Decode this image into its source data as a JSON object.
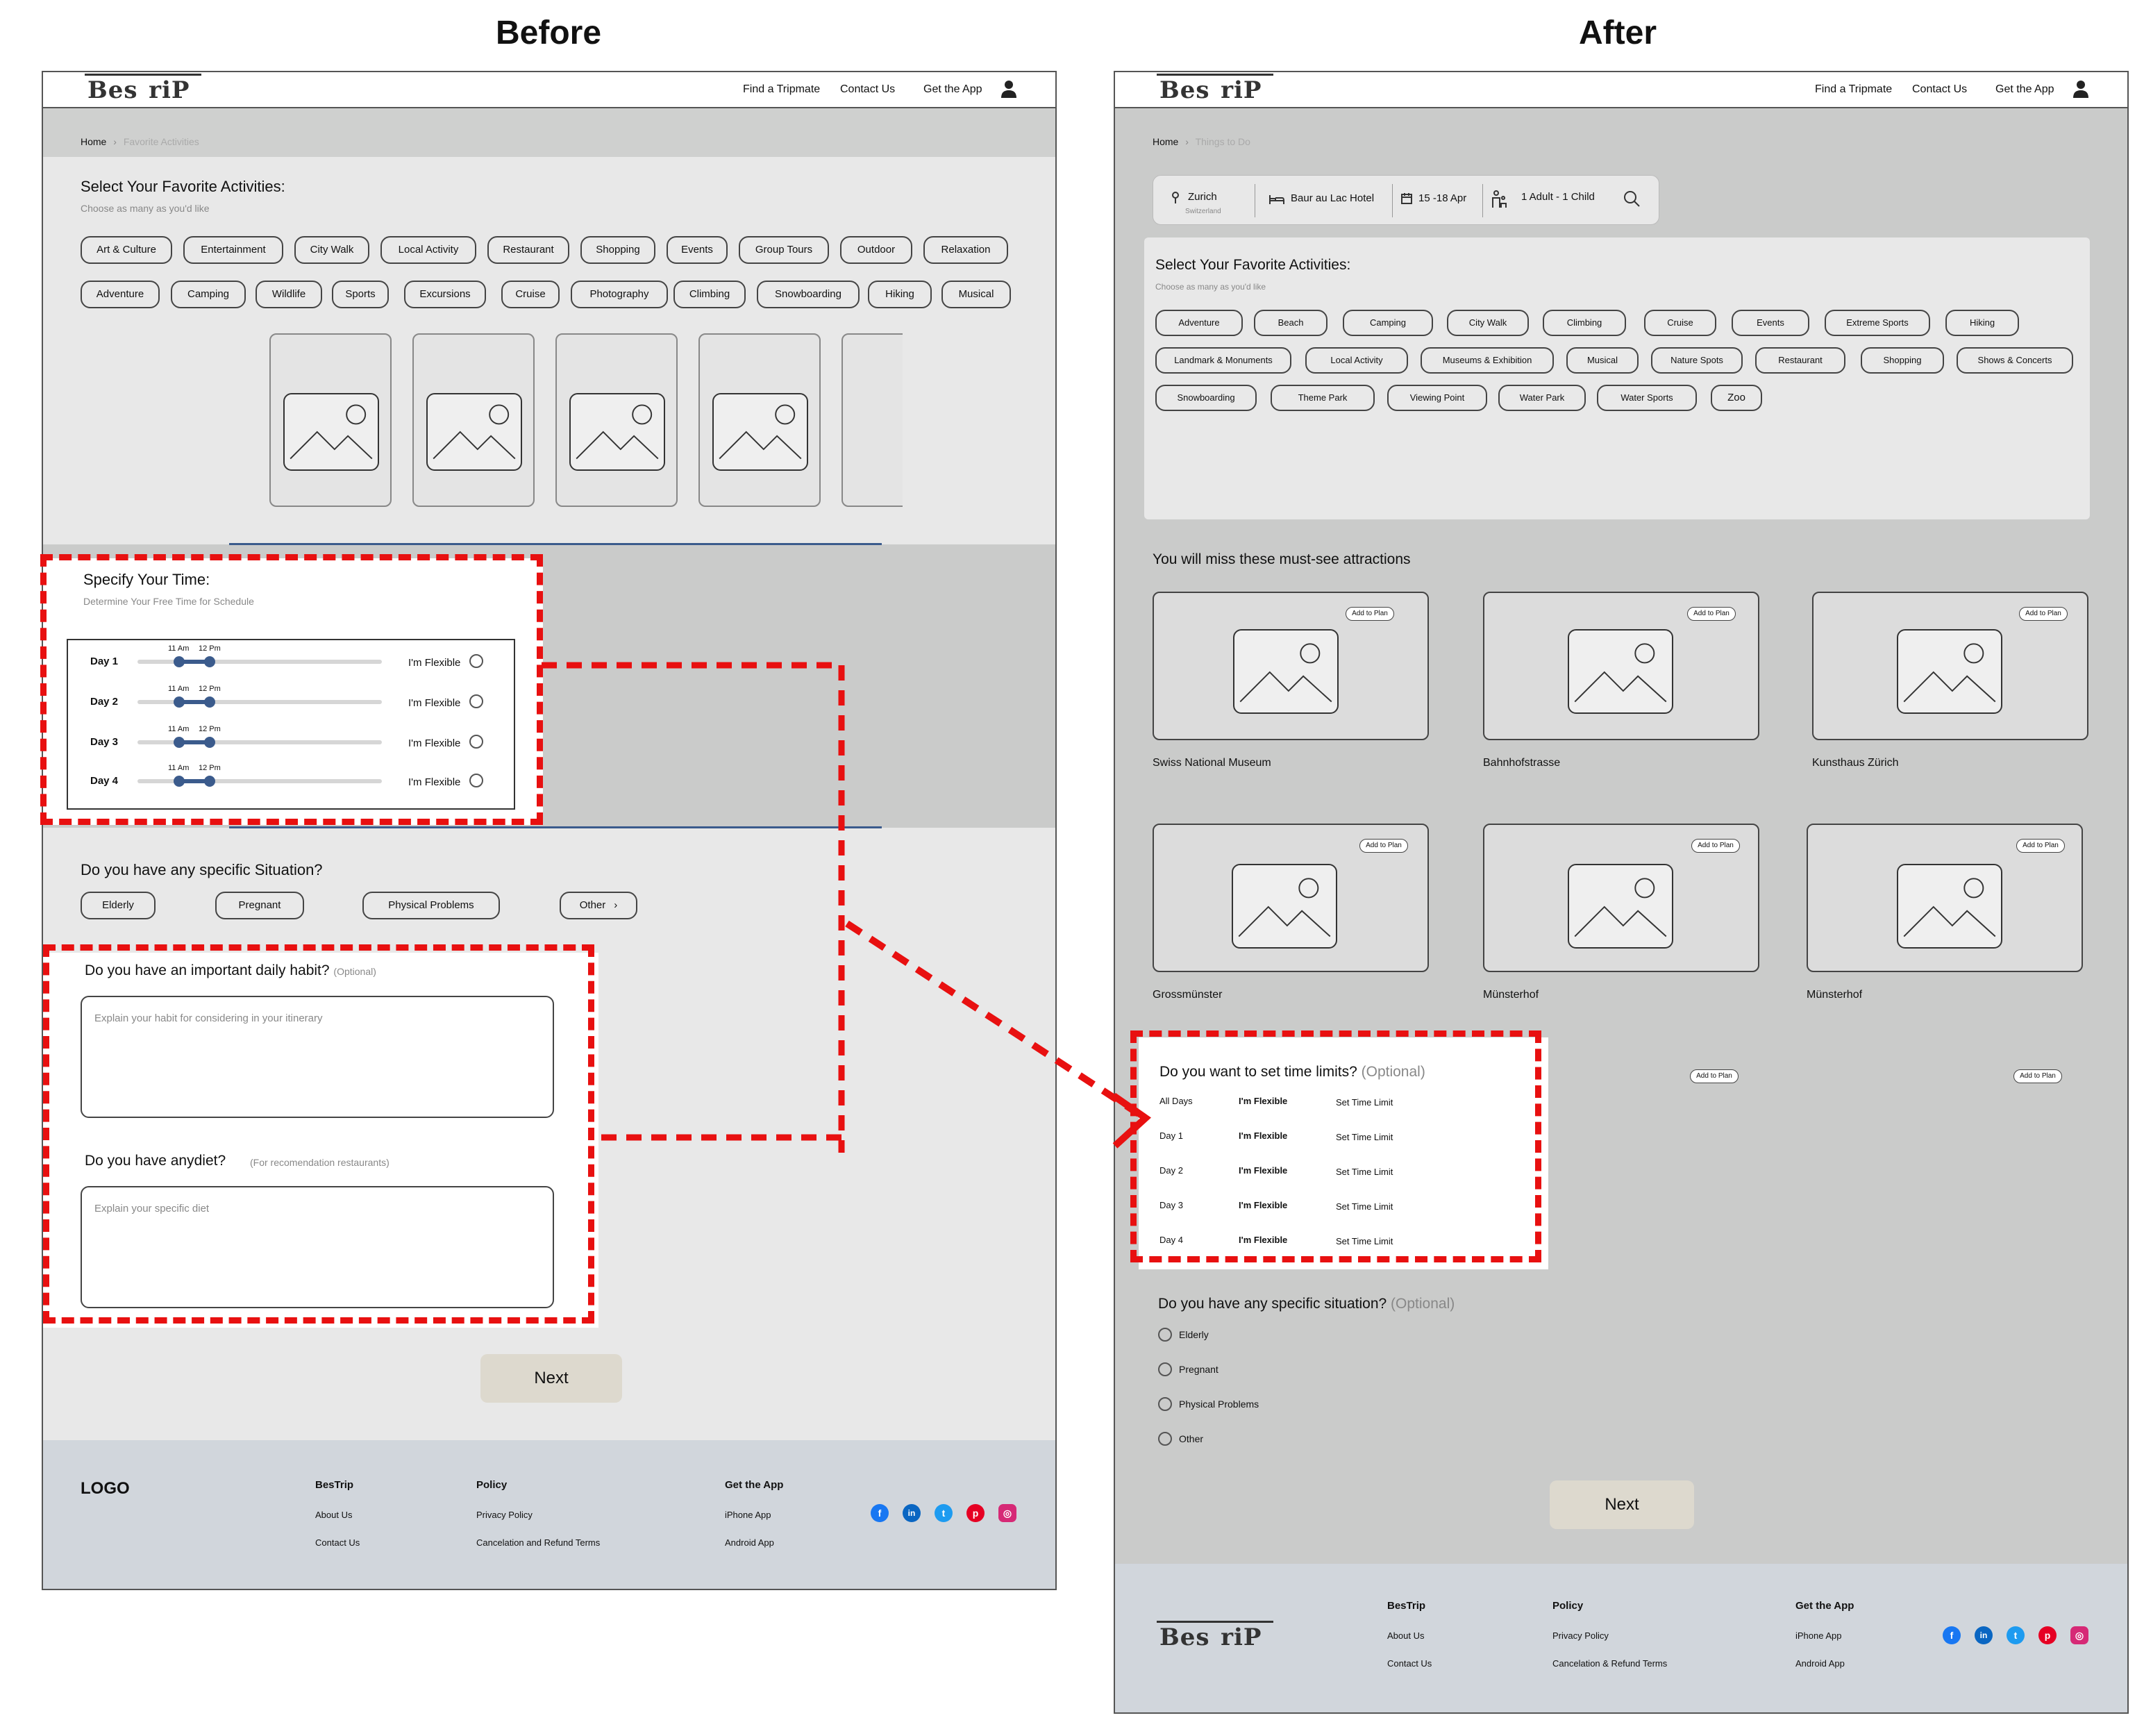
{
  "headings": {
    "before": "Before",
    "after": "After"
  },
  "nav": {
    "logo": "Bes  riP",
    "links": [
      "Find a Tripmate",
      "Contact Us",
      "Get the App"
    ]
  },
  "before": {
    "breadcrumb": {
      "home": "Home",
      "sep": "›",
      "current": "Favorite Activities"
    },
    "activities": {
      "title": "Select Your Favorite Activities:",
      "subtitle": "Choose as many as you'd like",
      "row1": [
        "Art & Culture",
        "Entertainment",
        "City Walk",
        "Local Activity",
        "Restaurant",
        "Shopping",
        "Events",
        "Group Tours",
        "Outdoor",
        "Relaxation"
      ],
      "row2": [
        "Adventure",
        "Camping",
        "Wildlife",
        "Sports",
        "Excursions",
        "Cruise",
        "Photography",
        "Climbing",
        "Snowboarding",
        "Hiking",
        "Musical"
      ]
    },
    "time": {
      "title": "Specify Your Time:",
      "subtitle": "Determine Your Free Time for Schedule",
      "days": [
        {
          "label": "Day 1",
          "from": "11 Am",
          "to": "12 Pm",
          "flex": "I'm Flexible"
        },
        {
          "label": "Day 2",
          "from": "11 Am",
          "to": "12 Pm",
          "flex": "I'm Flexible"
        },
        {
          "label": "Day 3",
          "from": "11 Am",
          "to": "12 Pm",
          "flex": "I'm Flexible"
        },
        {
          "label": "Day 4",
          "from": "11 Am",
          "to": "12 Pm",
          "flex": "I'm Flexible"
        }
      ]
    },
    "situation": {
      "title": "Do you have any specific Situation?",
      "options": [
        "Elderly",
        "Pregnant",
        "Physical Problems",
        "Other"
      ],
      "other_chev": "›"
    },
    "habit": {
      "title": "Do you have an important daily habit?",
      "optional": "(Optional)",
      "placeholder": "Explain your habit for considering in your itinerary"
    },
    "diet": {
      "title": "Do you have anydiet?",
      "note": "(For recomendation restaurants)",
      "placeholder": "Explain your specific diet"
    },
    "next": "Next",
    "footer": {
      "logo": "LOGO",
      "col1": {
        "head": "BesTrip",
        "links": [
          "About Us",
          "Contact Us"
        ]
      },
      "col2": {
        "head": "Policy",
        "links": [
          "Privacy Policy",
          "Cancelation and Refund Terms"
        ]
      },
      "col3": {
        "head": "Get the App",
        "links": [
          "iPhone App",
          "Android App"
        ]
      }
    }
  },
  "after": {
    "breadcrumb": {
      "home": "Home",
      "sep": "›",
      "current": "Things to Do"
    },
    "search": {
      "city": "Zurich",
      "country": "Switzerland",
      "hotel": "Baur au Lac Hotel",
      "dates": "15 -18 Apr",
      "guests": "1 Adult - 1 Child"
    },
    "activities": {
      "title": "Select Your Favorite Activities:",
      "subtitle": "Choose as many as you'd like",
      "row1": [
        "Adventure",
        "Beach",
        "Camping",
        "City Walk",
        "Climbing",
        "Cruise",
        "Events",
        "Extreme Sports",
        "Hiking"
      ],
      "row2": [
        "Landmark & Monuments",
        "Local Activity",
        "Museums & Exhibition",
        "Musical",
        "Nature Spots",
        "Restaurant",
        "Shopping",
        "Shows & Concerts"
      ],
      "row3": [
        "Snowboarding",
        "Theme Park",
        "Viewing Point",
        "Water Park",
        "Water Sports",
        "Zoo"
      ]
    },
    "attractions": {
      "title": "You will miss these must-see attractions",
      "add": "Add to Plan",
      "items": [
        "Swiss National Museum",
        "Bahnhofstrasse",
        "Kunsthaus Zürich",
        "Grossmünster",
        "Münsterhof",
        "Münsterhof"
      ]
    },
    "limits": {
      "title": "Do you want to set time limits?",
      "optional": "(Optional)",
      "rows": [
        {
          "label": "All Days",
          "flex": "I'm Flexible",
          "set": "Set Time Limit"
        },
        {
          "label": "Day 1",
          "flex": "I'm Flexible",
          "set": "Set Time Limit"
        },
        {
          "label": "Day 2",
          "flex": "I'm Flexible",
          "set": "Set Time Limit"
        },
        {
          "label": "Day 3",
          "flex": "I'm Flexible",
          "set": "Set Time Limit"
        },
        {
          "label": "Day 4",
          "flex": "I'm Flexible",
          "set": "Set Time Limit"
        }
      ]
    },
    "situation": {
      "title": "Do you have any specific situation?",
      "optional": "(Optional)",
      "options": [
        "Elderly",
        "Pregnant",
        "Physical Problems",
        "Other"
      ]
    },
    "next": "Next",
    "footer": {
      "logo": "Bes  riP",
      "col1": {
        "head": "BesTrip",
        "links": [
          "About Us",
          "Contact Us"
        ]
      },
      "col2": {
        "head": "Policy",
        "links": [
          "Privacy Policy",
          "Cancelation & Refund Terms"
        ]
      },
      "col3": {
        "head": "Get the App",
        "links": [
          "iPhone App",
          "Android App"
        ]
      }
    }
  },
  "colors": {
    "annotation": "#e81010",
    "slider": "#3b5b8c",
    "footer": "#d1d6dc"
  },
  "icons": [
    "user-icon",
    "image-placeholder-icon",
    "location-pin-icon",
    "bed-icon",
    "calendar-icon",
    "guests-icon",
    "search-icon",
    "facebook-icon",
    "linkedin-icon",
    "twitter-icon",
    "pinterest-icon",
    "instagram-icon"
  ]
}
